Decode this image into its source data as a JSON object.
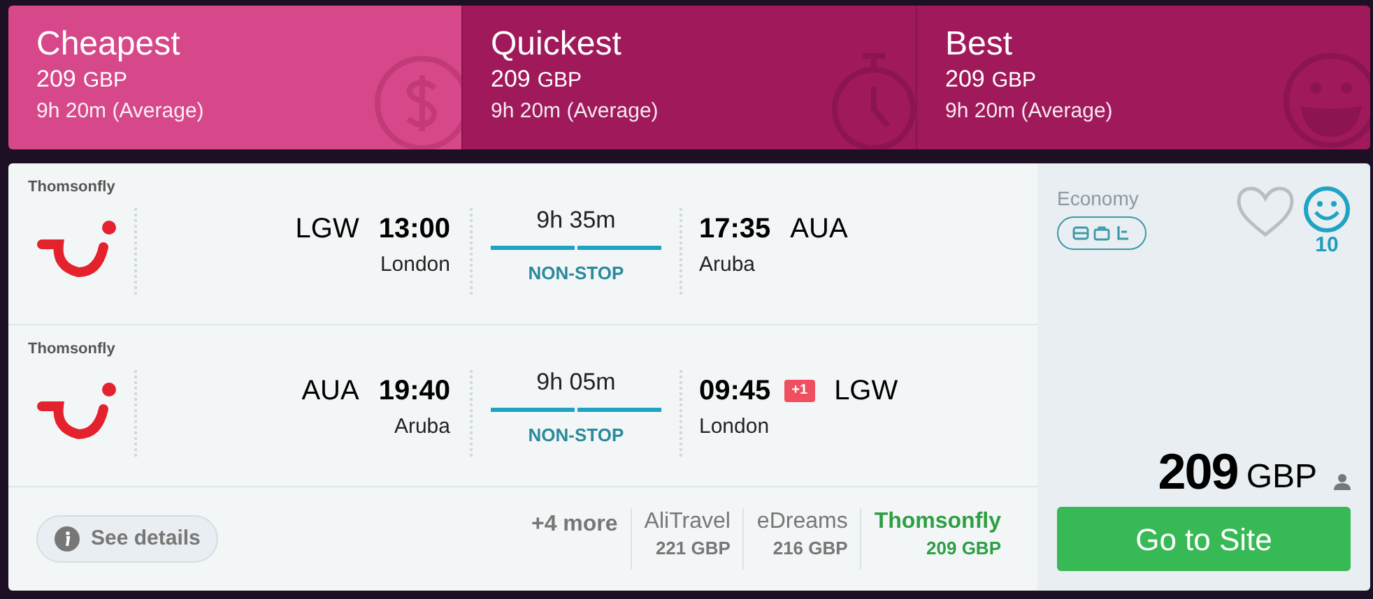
{
  "sort_tabs": [
    {
      "label": "Cheapest",
      "price": "209",
      "currency": "GBP",
      "duration": "9h 20m (Average)",
      "kind": "dollar",
      "selected": true
    },
    {
      "label": "Quickest",
      "price": "209",
      "currency": "GBP",
      "duration": "9h 20m (Average)",
      "kind": "stopwatch",
      "selected": false
    },
    {
      "label": "Best",
      "price": "209",
      "currency": "GBP",
      "duration": "9h 20m (Average)",
      "kind": "smiley",
      "selected": false
    }
  ],
  "legs": [
    {
      "airline": "Thomsonfly",
      "from_code": "LGW",
      "depart": "13:00",
      "from_city": "London",
      "duration": "9h 35m",
      "stops": "NON-STOP",
      "arrive": "17:35",
      "to_code": "AUA",
      "to_city": "Aruba"
    },
    {
      "airline": "Thomsonfly",
      "from_code": "AUA",
      "depart": "19:40",
      "from_city": "Aruba",
      "duration": "9h 05m",
      "stops": "NON-STOP",
      "arrive": "09:45",
      "day_offset": "+1",
      "to_code": "LGW",
      "to_city": "London"
    }
  ],
  "details_button": "See details",
  "more_providers": "+4 more",
  "providers": [
    {
      "name": "AliTravel",
      "price": "221 GBP",
      "selected": false
    },
    {
      "name": "eDreams",
      "price": "216 GBP",
      "selected": false
    },
    {
      "name": "Thomsonfly",
      "price": "209 GBP",
      "selected": true
    }
  ],
  "cabin": "Economy",
  "favorite": false,
  "score": "10",
  "price": "209",
  "currency": "GBP",
  "cta": "Go to Site"
}
